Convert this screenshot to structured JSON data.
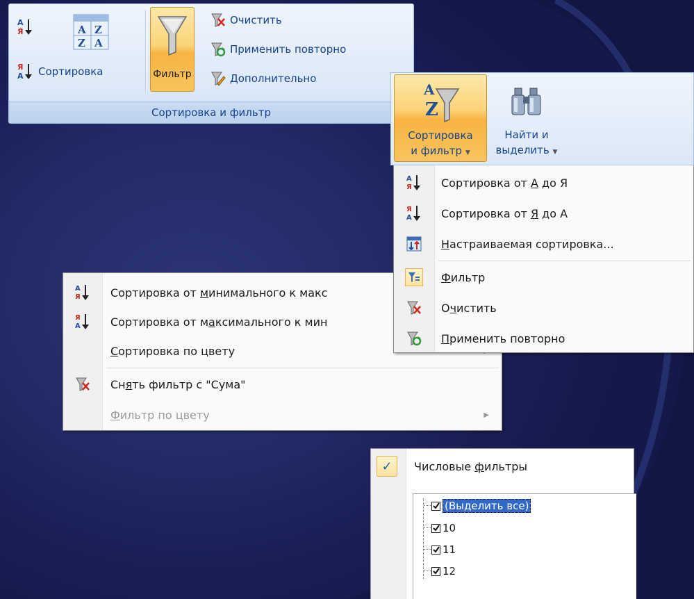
{
  "ribbon1": {
    "sort_asc_label": "",
    "sort_desc_label": "",
    "sort_label": "Сортировка",
    "filter_label": "Фильтр",
    "clear_label": "Очистить",
    "reapply_label": "Применить повторно",
    "advanced_label": "Дополнительно",
    "group_label": "Сортировка и фильтр"
  },
  "ribbon2": {
    "sortfilter_line1": "Сортировка",
    "sortfilter_line2": "и фильтр",
    "find_line1": "Найти и",
    "find_line2": "выделить"
  },
  "menu1": {
    "items": [
      {
        "pre": "Сортировка от ",
        "u": "А",
        "post": " до Я"
      },
      {
        "pre": "Сортировка от ",
        "u": "Я",
        "post": " до А"
      },
      {
        "pre": "",
        "u": "Н",
        "post": "астраиваемая сортировка..."
      },
      {
        "pre": "",
        "u": "Ф",
        "post": "ильтр"
      },
      {
        "pre": "О",
        "u": "ч",
        "post": "истить"
      },
      {
        "pre": "",
        "u": "П",
        "post": "рименить повторно"
      }
    ]
  },
  "menu2": {
    "items": [
      {
        "pre": "Сортировка от ",
        "u": "м",
        "post": "инимального к макс"
      },
      {
        "pre": "Сортировка от м",
        "u": "а",
        "post": "ксимального к мин"
      },
      {
        "pre": "",
        "u": "С",
        "post": "ортировка по цвету"
      },
      {
        "pre": "Сн",
        "u": "я",
        "post": "ть фильтр с \"Сума\""
      },
      {
        "pre": "",
        "u": "Ф",
        "post": "ильтр по цвету"
      }
    ]
  },
  "filter_list": {
    "numeric_filters_pre": "Числовые ",
    "numeric_filters_u": "ф",
    "numeric_filters_post": "ильтры",
    "items": [
      "(Выделить все)",
      "10",
      "11",
      "12"
    ]
  },
  "colors": {
    "ribbon_text": "#15428b",
    "active_orange": "#f7b443",
    "selection_blue": "#3169c6"
  }
}
